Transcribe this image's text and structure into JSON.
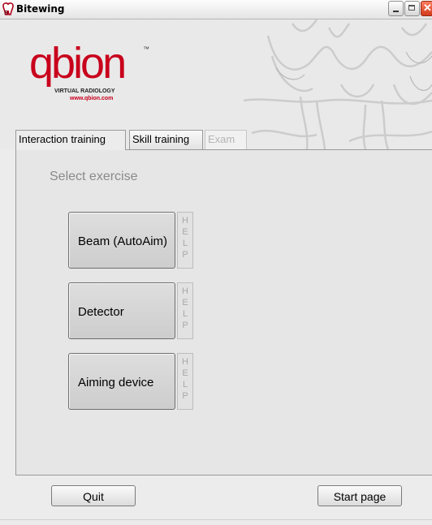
{
  "window": {
    "title": "Bitewing",
    "icon": "tooth-icon"
  },
  "logo": {
    "word": "qbion",
    "tm": "™",
    "subtitle": "VIRTUAL RADIOLOGY",
    "url": "www.qbion.com",
    "brand_color": "#c8001c"
  },
  "tabs": [
    {
      "label": "Interaction training",
      "active": true
    },
    {
      "label": "Skill training",
      "active": false
    },
    {
      "label": "Exam",
      "active": false,
      "disabled": true
    }
  ],
  "main": {
    "select_label": "Select exercise",
    "exercises": [
      {
        "label": "Beam (AutoAim)"
      },
      {
        "label": "Detector"
      },
      {
        "label": "Aiming device"
      }
    ],
    "help_letters": [
      "H",
      "E",
      "L",
      "P"
    ]
  },
  "footer": {
    "quit_label": "Quit",
    "start_label": "Start page"
  }
}
